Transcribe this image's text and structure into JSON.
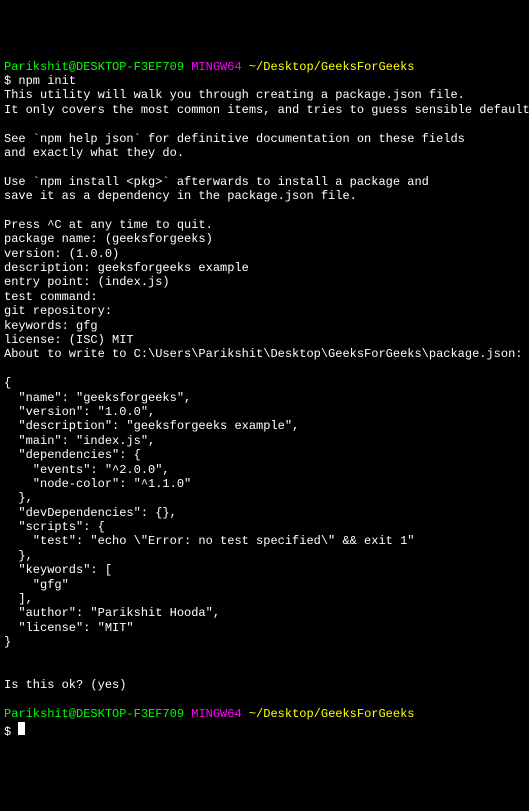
{
  "prompt1": {
    "user": "Parikshit@DESKTOP-F3EF709",
    "mingw": "MINGW64",
    "path": "~/Desktop/GeeksForGeeks",
    "dollar": "$",
    "command": "npm init"
  },
  "output": {
    "line1": "This utility will walk you through creating a package.json file.",
    "line2": "It only covers the most common items, and tries to guess sensible defaults.",
    "line3": "",
    "line4": "See `npm help json` for definitive documentation on these fields",
    "line5": "and exactly what they do.",
    "line6": "",
    "line7": "Use `npm install <pkg>` afterwards to install a package and",
    "line8": "save it as a dependency in the package.json file.",
    "line9": "",
    "line10": "Press ^C at any time to quit.",
    "line11": "package name: (geeksforgeeks)",
    "line12": "version: (1.0.0)",
    "line13": "description: geeksforgeeks example",
    "line14": "entry point: (index.js)",
    "line15": "test command:",
    "line16": "git repository:",
    "line17": "keywords: gfg",
    "line18": "license: (ISC) MIT",
    "line19": "About to write to C:\\Users\\Parikshit\\Desktop\\GeeksForGeeks\\package.json:",
    "line20": "",
    "line21": "{",
    "line22": "  \"name\": \"geeksforgeeks\",",
    "line23": "  \"version\": \"1.0.0\",",
    "line24": "  \"description\": \"geeksforgeeks example\",",
    "line25": "  \"main\": \"index.js\",",
    "line26": "  \"dependencies\": {",
    "line27": "    \"events\": \"^2.0.0\",",
    "line28": "    \"node-color\": \"^1.1.0\"",
    "line29": "  },",
    "line30": "  \"devDependencies\": {},",
    "line31": "  \"scripts\": {",
    "line32": "    \"test\": \"echo \\\"Error: no test specified\\\" && exit 1\"",
    "line33": "  },",
    "line34": "  \"keywords\": [",
    "line35": "    \"gfg\"",
    "line36": "  ],",
    "line37": "  \"author\": \"Parikshit Hooda\",",
    "line38": "  \"license\": \"MIT\"",
    "line39": "}",
    "line40": "",
    "line41": "",
    "line42": "Is this ok? (yes)",
    "line43": ""
  },
  "prompt2": {
    "user": "Parikshit@DESKTOP-F3EF709",
    "mingw": "MINGW64",
    "path": "~/Desktop/GeeksForGeeks",
    "dollar": "$"
  }
}
